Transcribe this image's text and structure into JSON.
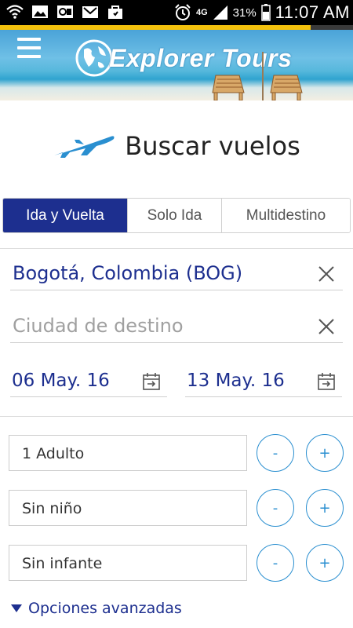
{
  "status_bar": {
    "network": "4G",
    "battery": "31%",
    "time": "11:07 AM",
    "icons": [
      "wifi-icon",
      "image-icon",
      "outlook-icon",
      "gmail-icon",
      "bag-icon",
      "alarm-icon",
      "signal-icon",
      "battery-icon"
    ]
  },
  "page_load_progress": 0.88,
  "header": {
    "brand": "Explorer Tours",
    "menu_icon": "hamburger-icon"
  },
  "search": {
    "title": "Buscar vuelos",
    "title_icon": "airplane-icon",
    "tabs": [
      {
        "label": "Ida y Vuelta",
        "active": true
      },
      {
        "label": "Solo Ida",
        "active": false
      },
      {
        "label": "Multidestino",
        "active": false
      }
    ],
    "origin": {
      "value": "Bogotá, Colombia (BOG)"
    },
    "destination": {
      "value": "",
      "placeholder": "Ciudad de destino"
    },
    "depart_date": "06 May. 16",
    "return_date": "13 May. 16"
  },
  "passengers": [
    {
      "label": "1 Adulto"
    },
    {
      "label": "Sin niño"
    },
    {
      "label": "Sin infante"
    }
  ],
  "controls": {
    "minus": "-",
    "plus": "+"
  },
  "advanced_options": "Opciones avanzadas",
  "colors": {
    "brand_navy": "#1d2f8f",
    "accent_blue": "#2a8fd0",
    "progress_yellow": "#f4c20d"
  }
}
